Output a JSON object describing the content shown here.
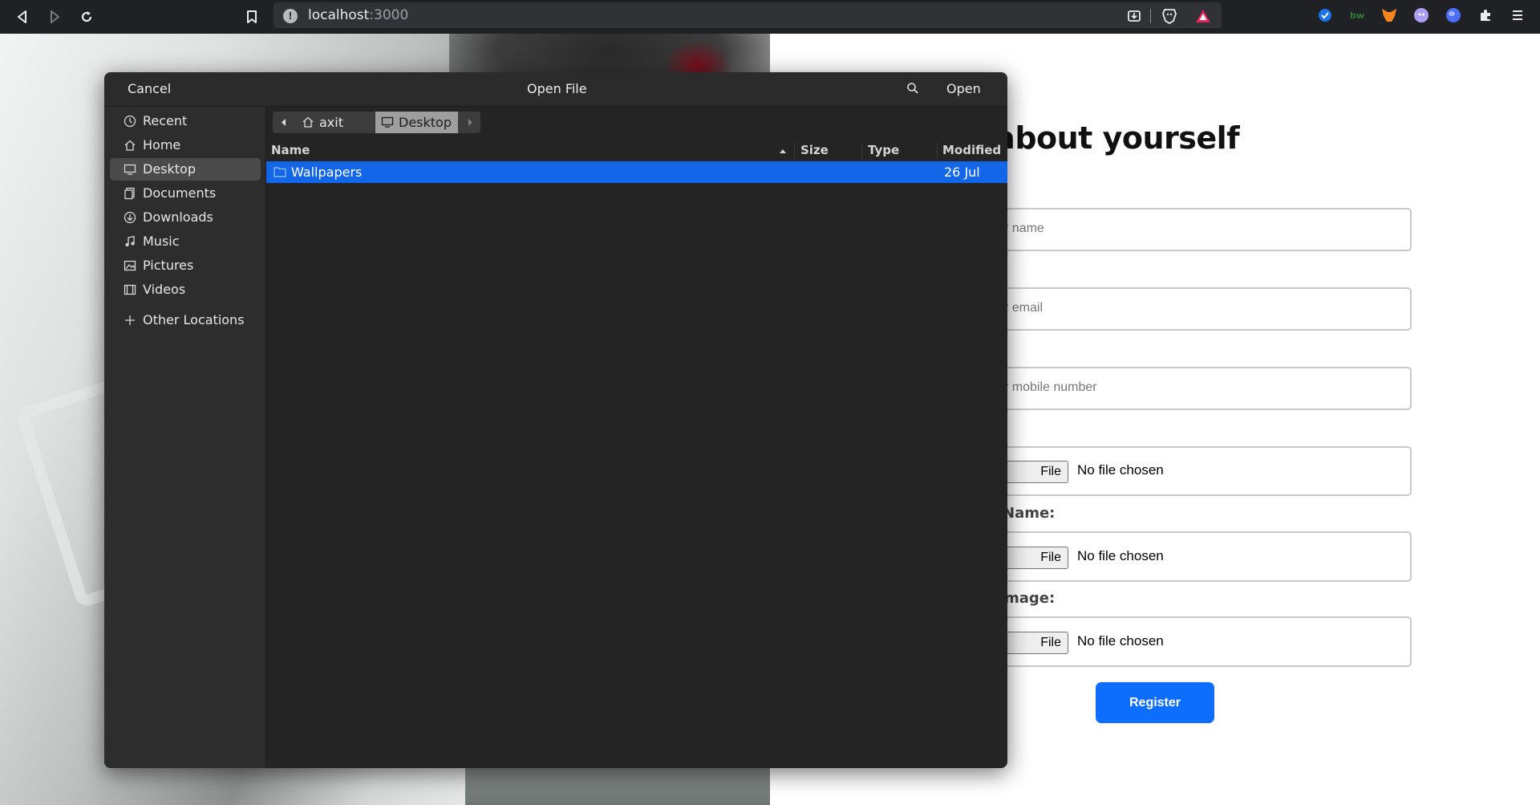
{
  "browser": {
    "url_host": "localhost",
    "url_port": ":3000",
    "ext_badge_text": "bw"
  },
  "page": {
    "form_title": "us a little about yourself",
    "inputs": [
      {
        "placeholder": "r name"
      },
      {
        "placeholder": "r email"
      },
      {
        "placeholder": "r mobile number"
      }
    ],
    "file_inputs": [
      {
        "label": "",
        "button": "File",
        "status": "No file chosen"
      },
      {
        "label": "Name:",
        "button": "File",
        "status": "No file chosen"
      },
      {
        "label": "mage:",
        "button": "File",
        "status": "No file chosen"
      }
    ],
    "register_label": "Register",
    "accent_color": "#0d6efd"
  },
  "dialog": {
    "title": "Open File",
    "cancel_label": "Cancel",
    "open_label": "Open",
    "sidebar": [
      {
        "label": "Recent",
        "icon": "clock-icon"
      },
      {
        "label": "Home",
        "icon": "home-icon"
      },
      {
        "label": "Desktop",
        "icon": "desktop-icon",
        "active": true
      },
      {
        "label": "Documents",
        "icon": "documents-icon"
      },
      {
        "label": "Downloads",
        "icon": "download-icon"
      },
      {
        "label": "Music",
        "icon": "music-icon"
      },
      {
        "label": "Pictures",
        "icon": "pictures-icon"
      },
      {
        "label": "Videos",
        "icon": "videos-icon"
      }
    ],
    "other_locations_label": "Other Locations",
    "path": [
      "axit",
      "Desktop"
    ],
    "columns": {
      "name": "Name",
      "size": "Size",
      "type": "Type",
      "modified": "Modified"
    },
    "files": [
      {
        "name": "Wallpapers",
        "size": "",
        "type": "",
        "modified": "26 Jul",
        "selected": true
      }
    ],
    "selection_color": "#1466e9"
  }
}
